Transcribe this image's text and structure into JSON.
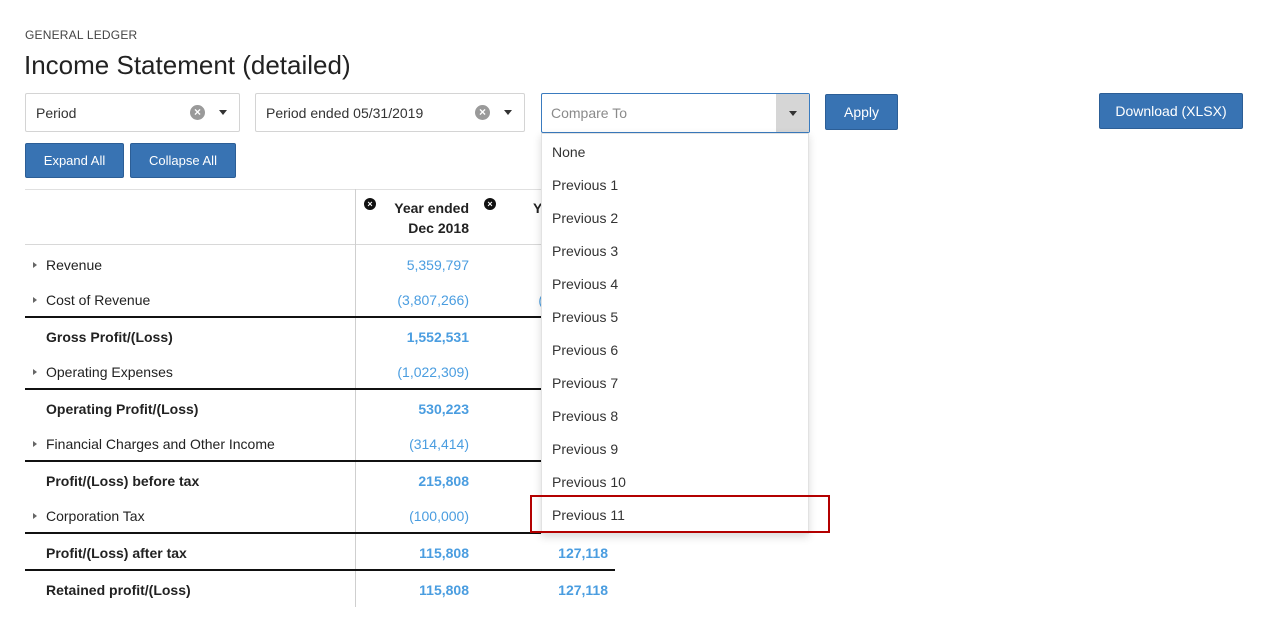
{
  "header": {
    "breadcrumb": "GENERAL LEDGER",
    "title": "Income Statement (detailed)"
  },
  "filters": {
    "period_type": "Period",
    "period_value": "Period ended 05/31/2019",
    "compare_placeholder": "Compare To",
    "clear_symbol": "×",
    "apply_label": "Apply",
    "download_label": "Download (XLSX)"
  },
  "actions": {
    "expand_all": "Expand All",
    "collapse_all": "Collapse All"
  },
  "dropdown": {
    "options": [
      "None",
      "Previous 1",
      "Previous 2",
      "Previous 3",
      "Previous 4",
      "Previous 5",
      "Previous 6",
      "Previous 7",
      "Previous 8",
      "Previous 9",
      "Previous 10",
      "Previous 11"
    ],
    "highlighted": "Previous 11"
  },
  "table": {
    "columns": [
      {
        "line1": "Year ended",
        "line2": "Dec 2018"
      },
      {
        "line1": "Y",
        "line2": ""
      }
    ],
    "remove_symbol": "×",
    "rows": [
      {
        "label": "Revenue",
        "v1": "5,359,797",
        "v2": "",
        "bold": false,
        "expandable": true
      },
      {
        "label": "Cost of Revenue",
        "v1": "(3,807,266)",
        "v2": "(",
        "bold": false,
        "expandable": true
      },
      {
        "label": "Gross Profit/(Loss)",
        "v1": "1,552,531",
        "v2": "",
        "bold": true,
        "expandable": false
      },
      {
        "label": "Operating Expenses",
        "v1": "(1,022,309)",
        "v2": "",
        "bold": false,
        "expandable": true
      },
      {
        "label": "Operating Profit/(Loss)",
        "v1": "530,223",
        "v2": "",
        "bold": true,
        "expandable": false
      },
      {
        "label": "Financial Charges and Other Income",
        "v1": "(314,414)",
        "v2": "",
        "bold": false,
        "expandable": true
      },
      {
        "label": "Profit/(Loss) before tax",
        "v1": "215,808",
        "v2": "",
        "bold": true,
        "expandable": false
      },
      {
        "label": "Corporation Tax",
        "v1": "(100,000)",
        "v2": "",
        "bold": false,
        "expandable": true
      },
      {
        "label": "Profit/(Loss) after tax",
        "v1": "115,808",
        "v2": "127,118",
        "bold": true,
        "expandable": false
      },
      {
        "label": "Retained profit/(Loss)",
        "v1": "115,808",
        "v2": "127,118",
        "bold": true,
        "expandable": false
      }
    ]
  },
  "colors": {
    "primary_button": "#3873b3",
    "value_blue": "#4a9de0",
    "highlight_red": "#b30000"
  }
}
